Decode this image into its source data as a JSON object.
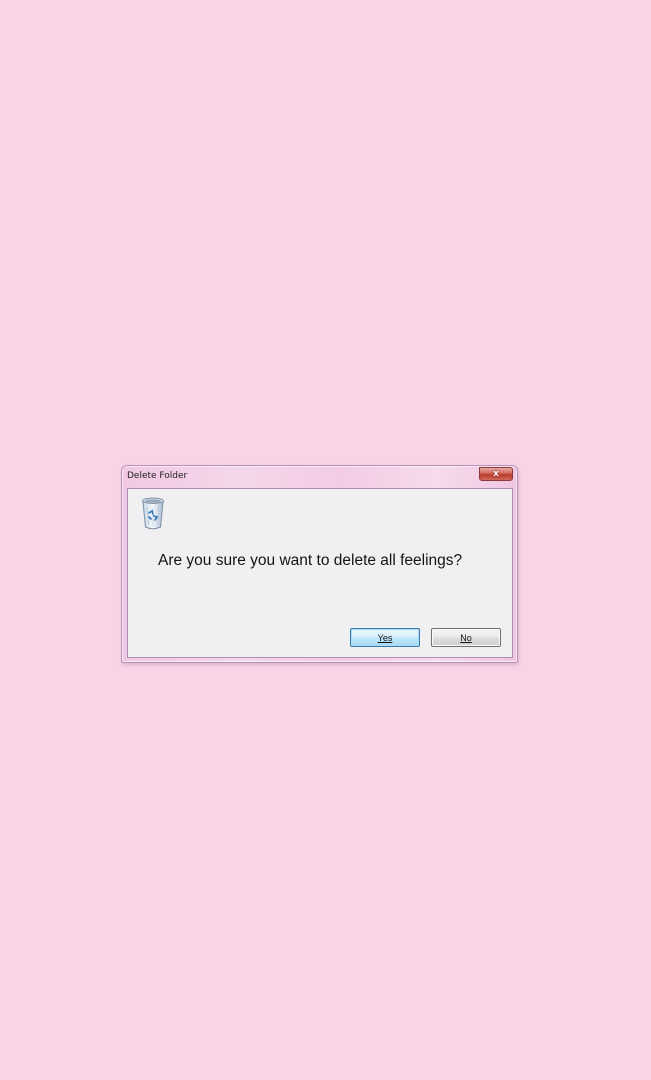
{
  "dialog": {
    "title": "Delete Folder",
    "close_label": "x",
    "icon": "recycle-bin-icon",
    "message": "Are you sure you want to delete all feelings?",
    "yes_label": "Yes",
    "no_label": "No"
  },
  "colors": {
    "background": "#f9d3e6",
    "frame": "#f3cbe6",
    "client": "#f0eff1",
    "default_button_border": "#3d7bad",
    "close_button": "#c4473a"
  }
}
